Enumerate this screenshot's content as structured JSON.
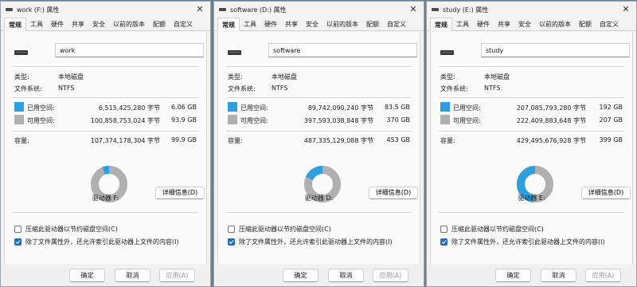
{
  "windows": [
    {
      "title": "work (F:) 属性",
      "tabs": [
        "常规",
        "工具",
        "硬件",
        "共享",
        "安全",
        "以前的版本",
        "配额",
        "自定义"
      ],
      "active_tab": 0,
      "name_value": "work",
      "type_label": "类型:",
      "type_value": "本地磁盘",
      "fs_label": "文件系统:",
      "fs_value": "NTFS",
      "used_label": "已用空间:",
      "used_bytes": "6,515,425,280 字节",
      "used_size": "6.06 GB",
      "free_label": "可用空间:",
      "free_bytes": "100,858,753,024 字节",
      "free_size": "93.9 GB",
      "capacity_label": "容量:",
      "capacity_bytes": "107,374,178,304 字节",
      "capacity_size": "99.9 GB",
      "used_fraction": 0.0607,
      "drive_label": "驱动器 F:",
      "details_button": "详细信息(D)",
      "compress_label": "压缩此驱动器以节约磁盘空间(C)",
      "compress_checked": false,
      "index_label": "除了文件属性外，还允许索引此驱动器上文件的内容(I)",
      "index_checked": true,
      "ok_button": "确定",
      "cancel_button": "取消",
      "apply_button": "应用(A)"
    },
    {
      "title": "software (D:) 属性",
      "tabs": [
        "常规",
        "工具",
        "硬件",
        "共享",
        "安全",
        "以前的版本",
        "配额",
        "自定义"
      ],
      "active_tab": 0,
      "name_value": "software",
      "type_label": "类型:",
      "type_value": "本地磁盘",
      "fs_label": "文件系统:",
      "fs_value": "NTFS",
      "used_label": "已用空间:",
      "used_bytes": "89,742,090,240 字节",
      "used_size": "83.5 GB",
      "free_label": "可用空间:",
      "free_bytes": "397,593,038,848 字节",
      "free_size": "370 GB",
      "capacity_label": "容量:",
      "capacity_bytes": "487,335,129,088 字节",
      "capacity_size": "453 GB",
      "used_fraction": 0.1842,
      "drive_label": "驱动器 D:",
      "details_button": "详细信息(D)",
      "compress_label": "压缩此驱动器以节约磁盘空间(C)",
      "compress_checked": false,
      "index_label": "除了文件属性外，还允许索引此驱动器上文件的内容(I)",
      "index_checked": true,
      "ok_button": "确定",
      "cancel_button": "取消",
      "apply_button": "应用(A)"
    },
    {
      "title": "study (E:) 属性",
      "tabs": [
        "常规",
        "工具",
        "硬件",
        "共享",
        "安全",
        "以前的版本",
        "配额",
        "自定义"
      ],
      "active_tab": 0,
      "name_value": "study",
      "type_label": "类型:",
      "type_value": "本地磁盘",
      "fs_label": "文件系统:",
      "fs_value": "NTFS",
      "used_label": "已用空间:",
      "used_bytes": "207,085,793,280 字节",
      "used_size": "192 GB",
      "free_label": "可用空间:",
      "free_bytes": "222,409,883,648 字节",
      "free_size": "207 GB",
      "capacity_label": "容量:",
      "capacity_bytes": "429,495,676,928 字节",
      "capacity_size": "399 GB",
      "used_fraction": 0.4822,
      "drive_label": "驱动器 E:",
      "details_button": "详细信息(D)",
      "compress_label": "压缩此驱动器以节约磁盘空间(C)",
      "compress_checked": false,
      "index_label": "除了文件属性外，还允许索引此驱动器上文件的内容(I)",
      "index_checked": true,
      "ok_button": "确定",
      "cancel_button": "取消",
      "apply_button": "应用(A)"
    }
  ],
  "colors": {
    "used": "#2d9fdd",
    "free": "#b0b0b0"
  },
  "icons": {
    "drive": "drive-icon",
    "close": "close-icon",
    "check": "checkmark-icon"
  }
}
